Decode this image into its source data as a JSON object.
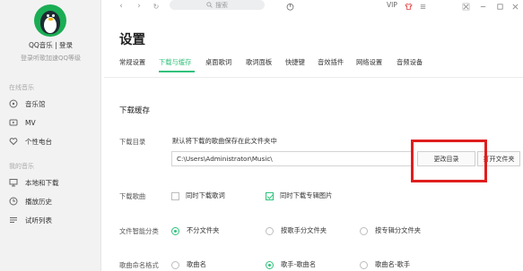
{
  "sidebar": {
    "user_name": "QQ音乐 | 登录",
    "user_sub": "登录听歌加速QQ等级",
    "section_online": "在线音乐",
    "online_items": [
      {
        "label": "音乐馆",
        "icon": "music-hall-icon"
      },
      {
        "label": "MV",
        "icon": "mv-icon"
      },
      {
        "label": "个性电台",
        "icon": "radio-heart-icon"
      }
    ],
    "section_mine": "我的音乐",
    "mine_items": [
      {
        "label": "本地和下载",
        "icon": "computer-icon"
      },
      {
        "label": "播放历史",
        "icon": "history-icon"
      },
      {
        "label": "试听列表",
        "icon": "list-icon"
      }
    ]
  },
  "topbar": {
    "back": "‹",
    "forward": "›",
    "refresh": "↻",
    "search_placeholder": "搜索",
    "vip": "VIP"
  },
  "page": {
    "title": "设置",
    "tabs": [
      "常规设置",
      "下载与缓存",
      "桌面歌词",
      "歌词面板",
      "快捷键",
      "音效插件",
      "网络设置",
      "音频设备"
    ],
    "active_tab_index": 1
  },
  "download": {
    "section_title": "下载缓存",
    "dir_label": "下载目录",
    "dir_hint": "默认将下载的歌曲保存在此文件夹中",
    "dir_path": "C:\\Users\\Administrator\\Music\\",
    "change_dir_button": "更改目录",
    "open_folder_button": "打开文件夹",
    "songs_label": "下载歌曲",
    "opt_lyrics": {
      "label": "同时下载歌词",
      "checked": false
    },
    "opt_cover": {
      "label": "同时下载专辑图片",
      "checked": true
    },
    "classify_label": "文件智能分类",
    "classify_options": [
      {
        "label": "不分文件夹",
        "selected": true
      },
      {
        "label": "按歌手分文件夹",
        "selected": false
      },
      {
        "label": "按专辑分文件夹",
        "selected": false
      }
    ],
    "naming_label": "歌曲命名格式",
    "naming_options": [
      {
        "label": "歌曲名",
        "selected": false
      },
      {
        "label": "歌手-歌曲名",
        "selected": true
      },
      {
        "label": "歌曲名-歌手",
        "selected": false
      }
    ]
  },
  "colors": {
    "accent": "#31c27c",
    "highlight": "#e01e1e"
  }
}
